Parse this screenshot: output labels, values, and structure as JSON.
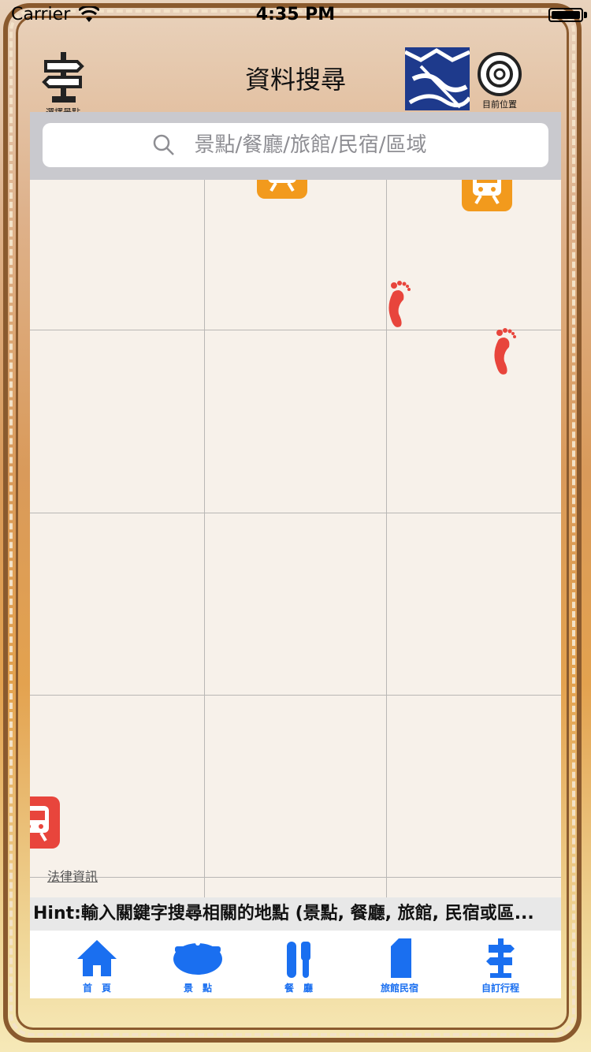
{
  "status_bar": {
    "carrier": "Carrier",
    "time": "4:35 PM"
  },
  "navbar": {
    "title": "資料搜尋",
    "left_button_label": "選擇景點",
    "right_button_label": "目前位置"
  },
  "search": {
    "placeholder": "景點/餐廳/旅館/民宿/區域",
    "value": ""
  },
  "map": {
    "legal_link": "法律資訊",
    "markers": [
      "train-marker",
      "train-marker",
      "footprint-marker",
      "footprint-marker",
      "train-marker"
    ]
  },
  "hint": "Hint:輸入關鍵字搜尋相關的地點 (景點, 餐廳, 旅館, 民宿或區...",
  "tabs": [
    {
      "label": "首　頁",
      "icon": "home-icon"
    },
    {
      "label": "景　點",
      "icon": "attraction-icon"
    },
    {
      "label": "餐　廳",
      "icon": "restaurant-icon"
    },
    {
      "label": "旅館民宿",
      "icon": "hotel-icon"
    },
    {
      "label": "自訂行程",
      "icon": "itinerary-icon"
    }
  ],
  "colors": {
    "accent_blue": "#1a6ff0",
    "train_orange": "#f29a1d",
    "train_red": "#e8453c",
    "footprint_red": "#e8453c",
    "frame_brown": "#8a5a2e"
  }
}
